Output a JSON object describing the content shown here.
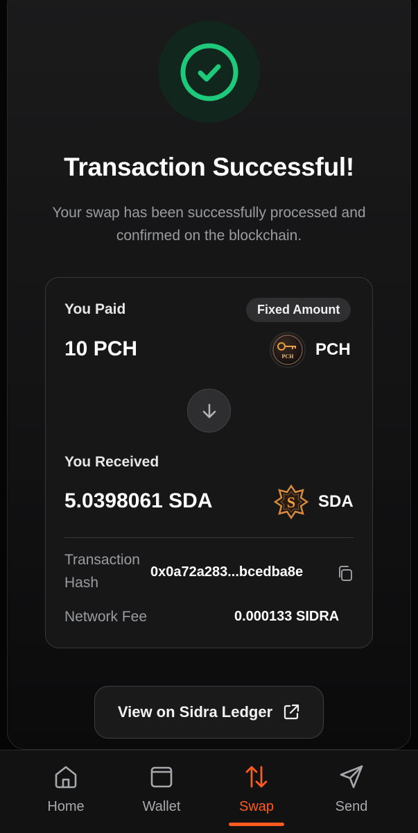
{
  "header": {
    "title": "Transaction Successful!",
    "subtitle": "Your swap has been successfully processed and confirmed on the blockchain."
  },
  "status_icon": "check-circle-icon",
  "summary": {
    "paid_label": "You Paid",
    "fixed_badge": "Fixed Amount",
    "paid_amount": "10 PCH",
    "paid_token": "PCH",
    "paid_token_logo_text": "PCH",
    "received_label": "You Received",
    "received_amount": "5.0398061 SDA",
    "received_token": "SDA",
    "received_token_logo_text": "S",
    "hash_label_line1": "Transaction",
    "hash_label_line2": "Hash",
    "hash_value": "0x0a72a283...bcedba8e",
    "fee_label": "Network Fee",
    "fee_value": "0.000133 SIDRA"
  },
  "actions": {
    "ledger_label": "View on Sidra Ledger"
  },
  "nav": {
    "items": [
      {
        "label": "Home",
        "icon": "home-icon",
        "active": false
      },
      {
        "label": "Wallet",
        "icon": "wallet-icon",
        "active": false
      },
      {
        "label": "Swap",
        "icon": "swap-icon",
        "active": true
      },
      {
        "label": "Send",
        "icon": "send-icon",
        "active": false
      }
    ]
  },
  "colors": {
    "accent": "#ff5a1f",
    "success": "#1ec97a",
    "background": "#050505"
  }
}
